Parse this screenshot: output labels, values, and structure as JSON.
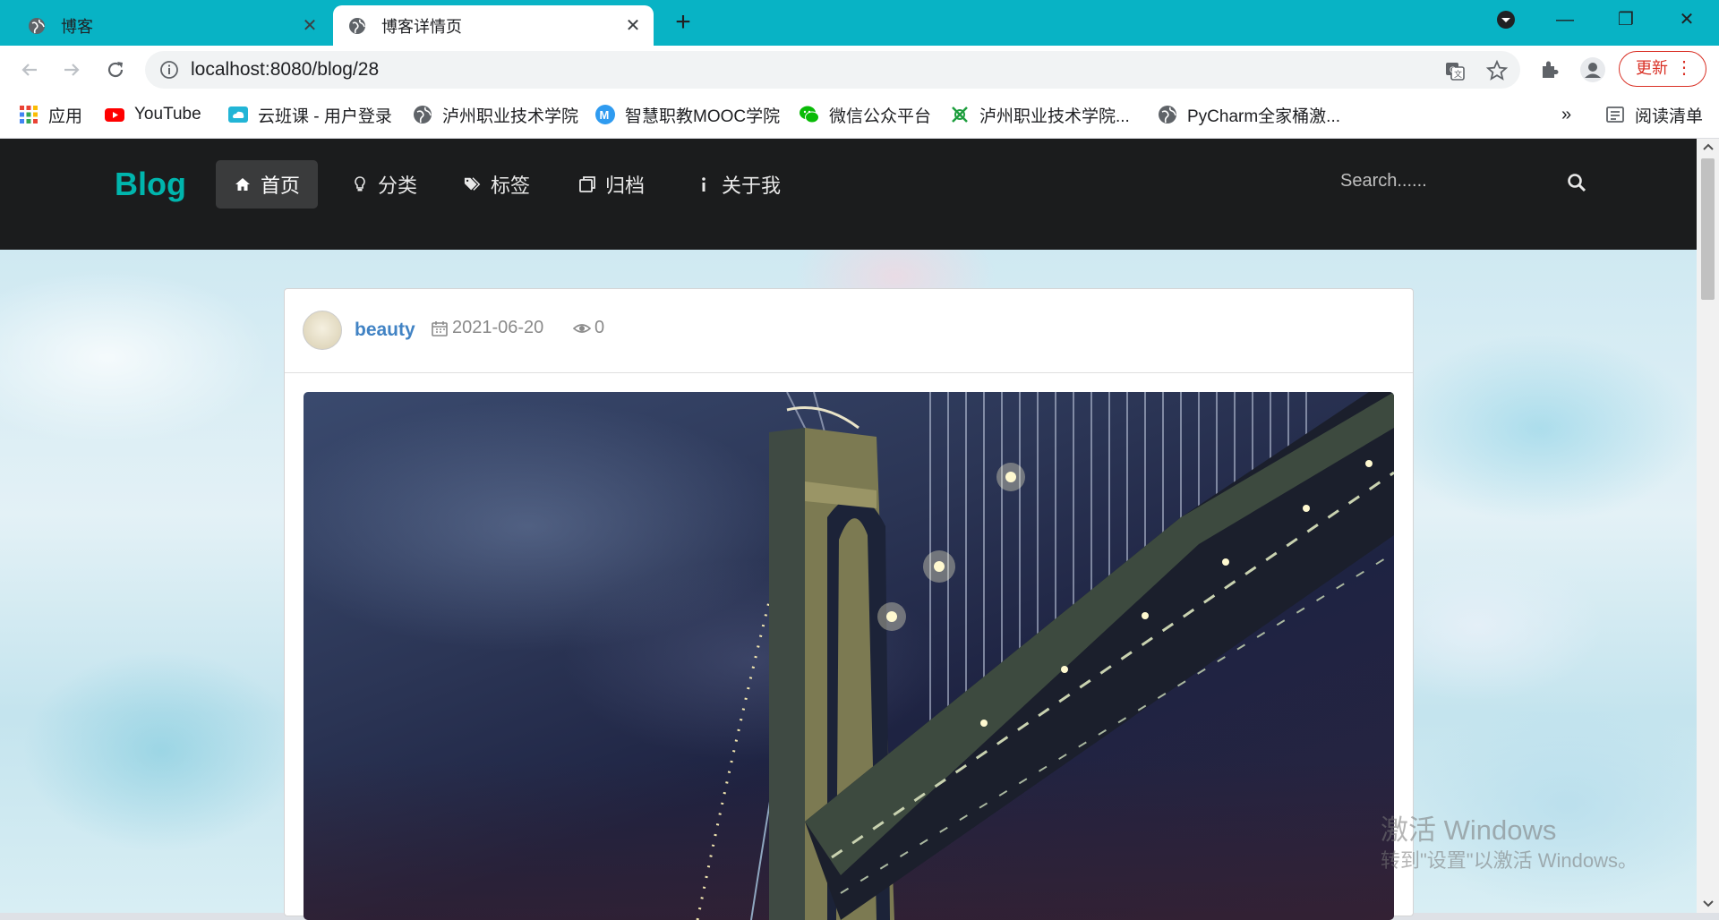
{
  "browser": {
    "tabs": [
      {
        "title": "博客",
        "active": false
      },
      {
        "title": "博客详情页",
        "active": true
      }
    ],
    "new_tab_label": "+",
    "url": "localhost:8080/blog/28",
    "update_label": "更新",
    "bookmarks": [
      {
        "label": "应用",
        "icon": "apps-grid-icon"
      },
      {
        "label": "YouTube",
        "icon": "youtube-icon"
      },
      {
        "label": "云班课 - 用户登录",
        "icon": "cloud-class-icon"
      },
      {
        "label": "泸州职业技术学院",
        "icon": "globe-icon"
      },
      {
        "label": "智慧职教MOOC学院",
        "icon": "mooc-icon"
      },
      {
        "label": "微信公众平台",
        "icon": "wechat-icon"
      },
      {
        "label": "泸州职业技术学院...",
        "icon": "school-logo-icon"
      },
      {
        "label": "PyCharm全家桶激...",
        "icon": "globe-icon"
      }
    ],
    "more_bookmarks": "»",
    "reading_list": "阅读清单"
  },
  "site": {
    "logo": "Blog",
    "nav": [
      {
        "label": "首页",
        "icon": "home-icon",
        "active": true
      },
      {
        "label": "分类",
        "icon": "idea-icon",
        "active": false
      },
      {
        "label": "标签",
        "icon": "tags-icon",
        "active": false
      },
      {
        "label": "归档",
        "icon": "clone-icon",
        "active": false
      },
      {
        "label": "关于我",
        "icon": "info-icon",
        "active": false
      }
    ],
    "search_placeholder": "Search......"
  },
  "post": {
    "author": "beauty",
    "date": "2021-06-20",
    "views": "0",
    "image": "night suspension bridge photo"
  },
  "watermark": {
    "line1": "激活 Windows",
    "line2": "转到\"设置\"以激活 Windows。"
  },
  "colors": {
    "tabbar": "#08b3c5",
    "navbar": "#1b1c1d",
    "logo": "#00b5ad",
    "author_link": "#4183c4",
    "update_red": "#d93025"
  }
}
